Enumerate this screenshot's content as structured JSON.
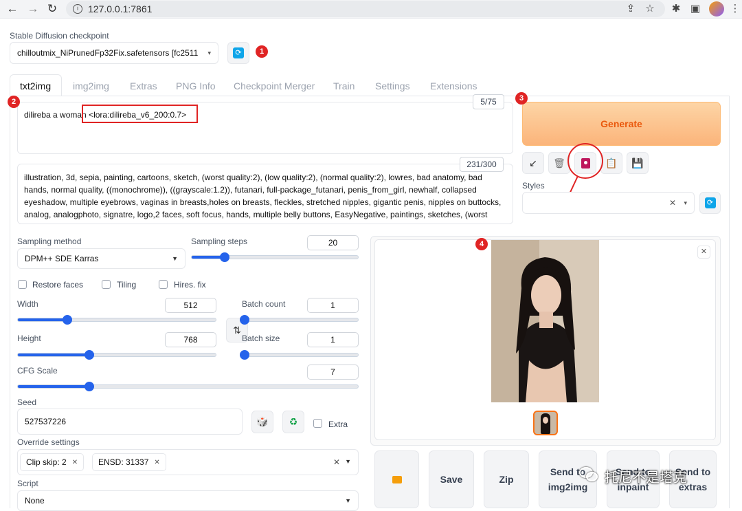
{
  "browser": {
    "url": "127.0.0.1:7861",
    "icons": [
      "back-icon",
      "forward-icon",
      "reload-icon",
      "info-icon",
      "share-icon",
      "star-icon",
      "extension-icon",
      "sidepanel-icon",
      "profile-icon"
    ]
  },
  "checkpoint": {
    "label": "Stable Diffusion checkpoint",
    "value": "chilloutmix_NiPrunedFp32Fix.safetensors [fc2511",
    "refresh_icon": "refresh-icon"
  },
  "annotations": {
    "b1": "1",
    "b2": "2",
    "b3": "3",
    "b4": "4"
  },
  "tabs": [
    "txt2img",
    "img2img",
    "Extras",
    "PNG Info",
    "Checkpoint Merger",
    "Train",
    "Settings",
    "Extensions"
  ],
  "prompt": {
    "prefix": "dilireba a woman ",
    "lora": "<lora:dilireba_v6_200:0.7>",
    "counter": "5/75"
  },
  "negative": {
    "text": "illustration, 3d, sepia, painting, cartoons, sketch, (worst quality:2), (low quality:2), (normal quality:2), lowres, bad anatomy, bad hands, normal quality, ((monochrome)), ((grayscale:1.2)), futanari, full-package_futanari, penis_from_girl, newhalf, collapsed eyeshadow, multiple eyebrows, vaginas in breasts,holes on breasts, fleckles, stretched nipples, gigantic penis, nipples on buttocks, analog, analogphoto, signatre, logo,2 faces, soft focus, hands, multiple belly buttons, EasyNegative, paintings, sketches, (worst",
    "counter": "231/300"
  },
  "generate": {
    "label": "Generate"
  },
  "tools": {
    "icons": [
      "arrow-icon",
      "trash-icon",
      "card-icon",
      "clipboard-icon",
      "save-icon"
    ]
  },
  "styles": {
    "label": "Styles"
  },
  "sampling": {
    "method_label": "Sampling method",
    "method_value": "DPM++ SDE Karras",
    "steps_label": "Sampling steps",
    "steps_value": "20",
    "steps_fraction": 0.2
  },
  "checks": {
    "restore": "Restore faces",
    "tiling": "Tiling",
    "hires": "Hires. fix",
    "extra": "Extra"
  },
  "size": {
    "width_label": "Width",
    "width_value": "512",
    "width_fraction": 0.25,
    "height_label": "Height",
    "height_value": "768",
    "height_fraction": 0.36,
    "batch_count_label": "Batch count",
    "batch_count_value": "1",
    "batch_count_fraction": 0.02,
    "batch_size_label": "Batch size",
    "batch_size_value": "1",
    "batch_size_fraction": 0.02,
    "swap_icon": "swap-icon"
  },
  "cfg": {
    "label": "CFG Scale",
    "value": "7",
    "fraction": 0.21
  },
  "seed": {
    "label": "Seed",
    "value": "527537226",
    "dice_icon": "dice-icon",
    "recycle_icon": "recycle-icon"
  },
  "override": {
    "label": "Override settings",
    "chips": [
      "Clip skip: 2",
      "ENSD: 31337"
    ]
  },
  "script": {
    "label": "Script",
    "value": "None"
  },
  "output": {
    "close_icon": "close-icon",
    "buttons": {
      "folder": "folder-icon",
      "save": "Save",
      "zip": "Zip",
      "img2img": "Send to img2img",
      "inpaint": "Send to inpaint",
      "extras": "Send to extras"
    }
  },
  "watermark": "托尼不是塔克",
  "colors": {
    "accent": "#2563eb",
    "generate": "#f97316",
    "annotation": "#e02424"
  }
}
